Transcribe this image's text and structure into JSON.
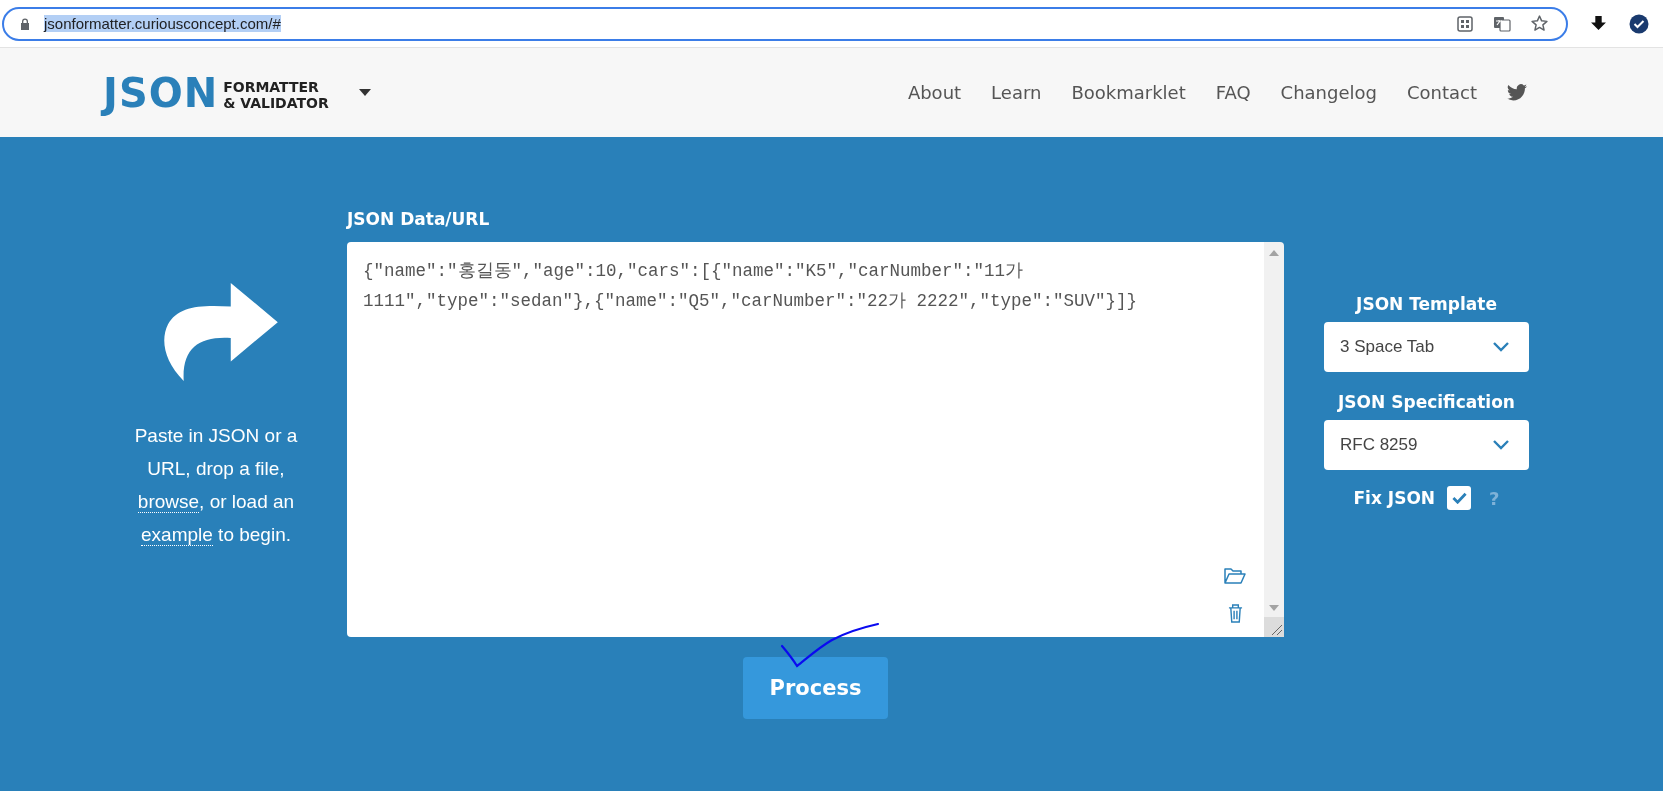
{
  "browser": {
    "url": "jsonformatter.curiousconcept.com/#",
    "url_selected": true
  },
  "header": {
    "logo": {
      "main": "JSON",
      "line_1": "FORMATTER",
      "line_2": "& VALIDATOR"
    },
    "nav": [
      {
        "label": "About"
      },
      {
        "label": "Learn"
      },
      {
        "label": "Bookmarklet"
      },
      {
        "label": "FAQ"
      },
      {
        "label": "Changelog"
      },
      {
        "label": "Contact"
      }
    ]
  },
  "intro": [
    {
      "kind": "text",
      "text": "Paste in JSON or a URL, drop a file, "
    },
    {
      "kind": "link",
      "text": "browse"
    },
    {
      "kind": "text",
      "text": ", or load an "
    },
    {
      "kind": "link",
      "text": "example"
    },
    {
      "kind": "text",
      "text": " to begin."
    }
  ],
  "editor": {
    "label": "JSON Data/URL",
    "value": "{\"name\":\"홍길동\",\"age\":10,\"cars\":[{\"name\":\"K5\",\"carNumber\":\"11가 1111\",\"type\":\"sedan\"},{\"name\":\"Q5\",\"carNumber\":\"22가 2222\",\"type\":\"SUV\"}]}"
  },
  "options": {
    "template": {
      "label": "JSON Template",
      "value": "3 Space Tab"
    },
    "specification": {
      "label": "JSON Specification",
      "value": "RFC 8259"
    },
    "fix_json": {
      "label": "Fix JSON",
      "checked": true,
      "help": "?"
    }
  },
  "process_button": "Process"
}
